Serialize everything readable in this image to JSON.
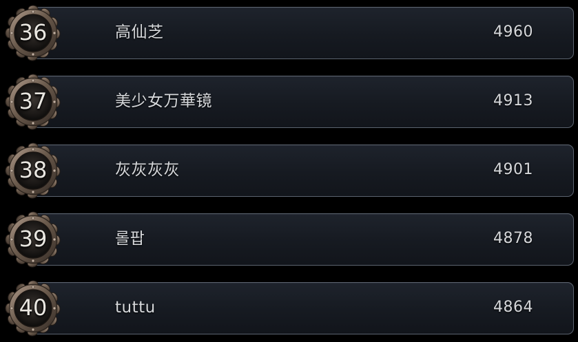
{
  "leaderboard": {
    "rows": [
      {
        "rank": "36",
        "name": "高仙芝",
        "score": "4960"
      },
      {
        "rank": "37",
        "name": "美少女万華镜",
        "score": "4913"
      },
      {
        "rank": "38",
        "name": "灰灰灰灰",
        "score": "4901"
      },
      {
        "rank": "39",
        "name": "롤팝",
        "score": "4878"
      },
      {
        "rank": "40",
        "name": "tuttu",
        "score": "4864"
      }
    ]
  },
  "colors": {
    "panel_border": "#5c6470",
    "panel_fill": "#1a1e25",
    "text": "#d6d8db",
    "badge_metal": "#6a5a4c"
  },
  "icons": {
    "rank_badge": "ornate-bronze-laurel-badge-icon"
  }
}
